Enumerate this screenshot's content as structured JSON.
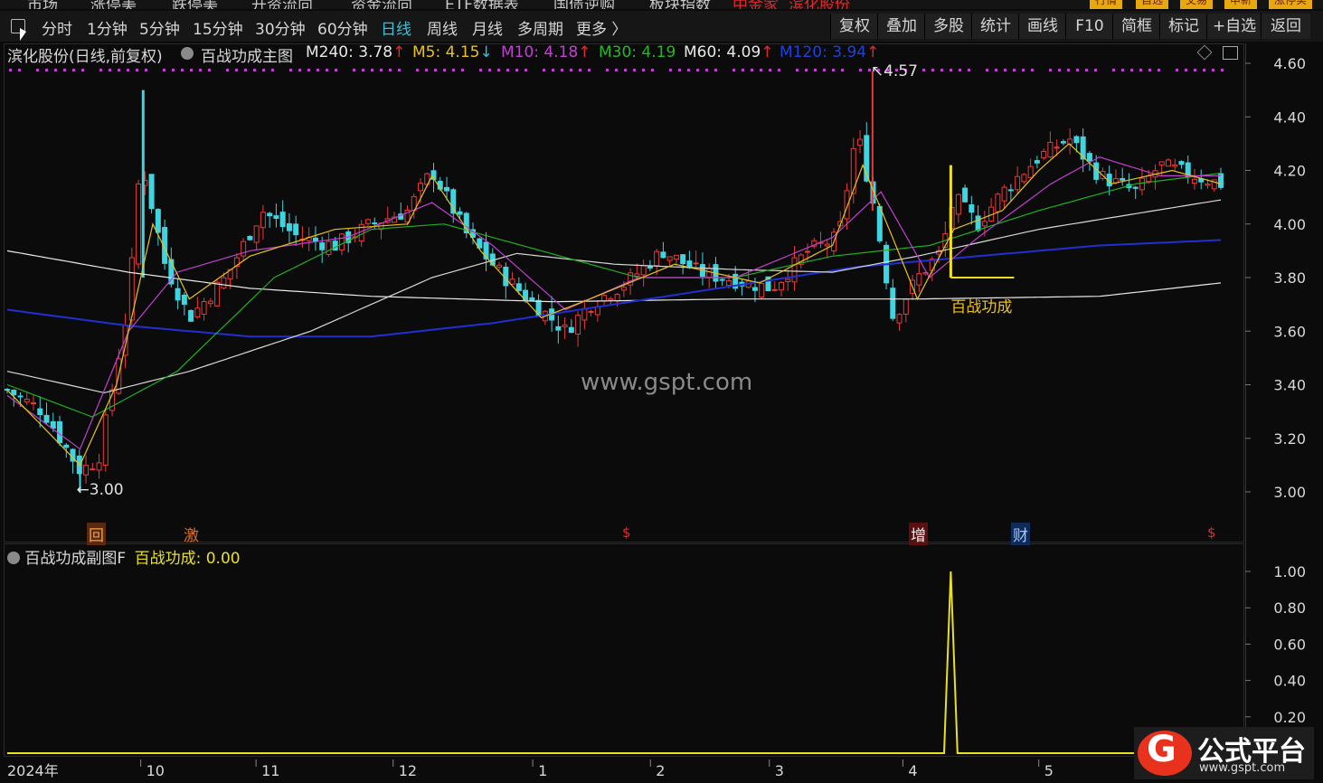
{
  "topnav": {
    "items": [
      "市场",
      "涨停美",
      "跌停美",
      "开资流向",
      "资金流向",
      "ETF数据表",
      "国债逆购",
      "板块指数",
      "中金家",
      "滨化股份"
    ],
    "right_tabs": [
      "行情",
      "自选",
      "交易",
      "申新",
      "涨停实"
    ]
  },
  "toolbar": {
    "periods": [
      "分时",
      "1分钟",
      "5分钟",
      "15分钟",
      "30分钟",
      "60分钟",
      "日线",
      "周线",
      "月线",
      "多周期",
      "更多 〉"
    ],
    "active_period": "日线",
    "buttons": [
      "复权",
      "叠加",
      "多股",
      "统计",
      "画线",
      "F10",
      "简框",
      "标记",
      "+自选",
      "返回"
    ]
  },
  "main_chart": {
    "stock_title": "滨化股份(日线,前复权)",
    "indicator_name": "百战功成主图",
    "ma_labels": [
      {
        "text": "M240: 3.78",
        "arrow": "↑",
        "color": "#e8e8e8"
      },
      {
        "text": "M5: 4.15",
        "arrow": "↓",
        "color": "#e8c21a"
      },
      {
        "text": "M10: 4.18",
        "arrow": "↑",
        "color": "#c040d0"
      },
      {
        "text": "M30: 4.19",
        "arrow": "",
        "color": "#25b825"
      },
      {
        "text": "M60: 4.09",
        "arrow": "↑",
        "color": "#e8e8e8"
      },
      {
        "text": "M120: 3.94",
        "arrow": "↑",
        "color": "#2040e0"
      }
    ],
    "high_label": "4.57",
    "low_label": "3.00",
    "annotation": "百战功成",
    "event_markers": [
      {
        "label": "回",
        "color": "#e07020"
      },
      {
        "label": "激",
        "color": "#e07020"
      },
      {
        "label": "$",
        "color": "#e02a2a"
      },
      {
        "label": "增",
        "color": "#c01818"
      },
      {
        "label": "财",
        "color": "#2a6ae0"
      },
      {
        "label": "$",
        "color": "#e02a2a"
      }
    ]
  },
  "sub_chart": {
    "indicator_name": "百战功成副图F",
    "value_label": "百战功成: 0.00"
  },
  "watermark": "www.gspt.com",
  "logo": {
    "title": "公式平台",
    "url": "www.gspt.com",
    "glyph": "G"
  },
  "chart_data": [
    {
      "type": "candlestick",
      "title": "滨化股份(日线,前复权)",
      "ylim": [
        2.92,
        4.65
      ],
      "y_ticks": [
        3.0,
        3.2,
        3.4,
        3.6,
        3.8,
        4.0,
        4.2,
        4.4,
        4.6
      ],
      "x_tick_labels": [
        "2024年",
        "10",
        "11",
        "12",
        "1",
        "2",
        "3",
        "4",
        "5"
      ],
      "high_marker": 4.57,
      "low_marker": 3.0,
      "close_path": [
        {
          "t": 0.0,
          "v": 3.38
        },
        {
          "t": 0.03,
          "v": 3.3
        },
        {
          "t": 0.06,
          "v": 3.08
        },
        {
          "t": 0.075,
          "v": 3.12
        },
        {
          "t": 0.085,
          "v": 3.35
        },
        {
          "t": 0.1,
          "v": 3.7
        },
        {
          "t": 0.11,
          "v": 4.25
        },
        {
          "t": 0.13,
          "v": 3.85
        },
        {
          "t": 0.15,
          "v": 3.65
        },
        {
          "t": 0.18,
          "v": 3.8
        },
        {
          "t": 0.21,
          "v": 4.05
        },
        {
          "t": 0.24,
          "v": 3.95
        },
        {
          "t": 0.27,
          "v": 3.92
        },
        {
          "t": 0.3,
          "v": 4.0
        },
        {
          "t": 0.33,
          "v": 4.05
        },
        {
          "t": 0.35,
          "v": 4.2
        },
        {
          "t": 0.38,
          "v": 3.95
        },
        {
          "t": 0.41,
          "v": 3.8
        },
        {
          "t": 0.44,
          "v": 3.68
        },
        {
          "t": 0.46,
          "v": 3.6
        },
        {
          "t": 0.48,
          "v": 3.7
        },
        {
          "t": 0.51,
          "v": 3.78
        },
        {
          "t": 0.54,
          "v": 3.9
        },
        {
          "t": 0.57,
          "v": 3.82
        },
        {
          "t": 0.6,
          "v": 3.79
        },
        {
          "t": 0.63,
          "v": 3.76
        },
        {
          "t": 0.66,
          "v": 3.9
        },
        {
          "t": 0.685,
          "v": 3.95
        },
        {
          "t": 0.7,
          "v": 4.35
        },
        {
          "t": 0.715,
          "v": 4.05
        },
        {
          "t": 0.73,
          "v": 3.65
        },
        {
          "t": 0.75,
          "v": 3.8
        },
        {
          "t": 0.77,
          "v": 3.9
        },
        {
          "t": 0.78,
          "v": 4.1
        },
        {
          "t": 0.8,
          "v": 4.0
        },
        {
          "t": 0.82,
          "v": 4.12
        },
        {
          "t": 0.85,
          "v": 4.25
        },
        {
          "t": 0.875,
          "v": 4.32
        },
        {
          "t": 0.9,
          "v": 4.18
        },
        {
          "t": 0.93,
          "v": 4.12
        },
        {
          "t": 0.95,
          "v": 4.22
        },
        {
          "t": 1.0,
          "v": 4.15
        }
      ],
      "series": [
        {
          "name": "M240",
          "last": 3.78,
          "color": "#e8e8e8",
          "points": [
            {
              "t": 0.0,
              "v": 3.9
            },
            {
              "t": 0.1,
              "v": 3.82
            },
            {
              "t": 0.2,
              "v": 3.76
            },
            {
              "t": 0.3,
              "v": 3.73
            },
            {
              "t": 0.45,
              "v": 3.71
            },
            {
              "t": 0.6,
              "v": 3.72
            },
            {
              "t": 0.75,
              "v": 3.72
            },
            {
              "t": 0.9,
              "v": 3.73
            },
            {
              "t": 1.0,
              "v": 3.78
            }
          ]
        },
        {
          "name": "M120",
          "last": 3.94,
          "color": "#2030d0",
          "points": [
            {
              "t": 0.0,
              "v": 3.68
            },
            {
              "t": 0.1,
              "v": 3.62
            },
            {
              "t": 0.2,
              "v": 3.58
            },
            {
              "t": 0.3,
              "v": 3.58
            },
            {
              "t": 0.4,
              "v": 3.63
            },
            {
              "t": 0.5,
              "v": 3.7
            },
            {
              "t": 0.6,
              "v": 3.77
            },
            {
              "t": 0.7,
              "v": 3.84
            },
            {
              "t": 0.8,
              "v": 3.88
            },
            {
              "t": 0.9,
              "v": 3.92
            },
            {
              "t": 1.0,
              "v": 3.94
            }
          ]
        },
        {
          "name": "M60",
          "last": 4.09,
          "color": "#d8d8d8",
          "points": [
            {
              "t": 0.0,
              "v": 3.45
            },
            {
              "t": 0.08,
              "v": 3.37
            },
            {
              "t": 0.15,
              "v": 3.45
            },
            {
              "t": 0.25,
              "v": 3.6
            },
            {
              "t": 0.35,
              "v": 3.8
            },
            {
              "t": 0.42,
              "v": 3.89
            },
            {
              "t": 0.5,
              "v": 3.85
            },
            {
              "t": 0.6,
              "v": 3.83
            },
            {
              "t": 0.68,
              "v": 3.82
            },
            {
              "t": 0.75,
              "v": 3.88
            },
            {
              "t": 0.85,
              "v": 3.98
            },
            {
              "t": 1.0,
              "v": 4.09
            }
          ]
        },
        {
          "name": "M30",
          "last": 4.19,
          "color": "#20b020",
          "points": [
            {
              "t": 0.0,
              "v": 3.4
            },
            {
              "t": 0.07,
              "v": 3.28
            },
            {
              "t": 0.14,
              "v": 3.45
            },
            {
              "t": 0.22,
              "v": 3.8
            },
            {
              "t": 0.3,
              "v": 3.98
            },
            {
              "t": 0.36,
              "v": 4.0
            },
            {
              "t": 0.44,
              "v": 3.9
            },
            {
              "t": 0.52,
              "v": 3.8
            },
            {
              "t": 0.6,
              "v": 3.8
            },
            {
              "t": 0.68,
              "v": 3.88
            },
            {
              "t": 0.76,
              "v": 3.92
            },
            {
              "t": 0.85,
              "v": 4.05
            },
            {
              "t": 0.93,
              "v": 4.15
            },
            {
              "t": 1.0,
              "v": 4.19
            }
          ]
        },
        {
          "name": "M10",
          "last": 4.18,
          "color": "#c040d0",
          "points": [
            {
              "t": 0.0,
              "v": 3.36
            },
            {
              "t": 0.06,
              "v": 3.16
            },
            {
              "t": 0.1,
              "v": 3.6
            },
            {
              "t": 0.14,
              "v": 3.82
            },
            {
              "t": 0.2,
              "v": 3.9
            },
            {
              "t": 0.28,
              "v": 3.95
            },
            {
              "t": 0.35,
              "v": 4.08
            },
            {
              "t": 0.4,
              "v": 3.92
            },
            {
              "t": 0.46,
              "v": 3.68
            },
            {
              "t": 0.52,
              "v": 3.8
            },
            {
              "t": 0.6,
              "v": 3.8
            },
            {
              "t": 0.68,
              "v": 3.95
            },
            {
              "t": 0.72,
              "v": 4.12
            },
            {
              "t": 0.76,
              "v": 3.8
            },
            {
              "t": 0.8,
              "v": 3.95
            },
            {
              "t": 0.86,
              "v": 4.15
            },
            {
              "t": 0.9,
              "v": 4.25
            },
            {
              "t": 0.95,
              "v": 4.18
            },
            {
              "t": 1.0,
              "v": 4.18
            }
          ]
        },
        {
          "name": "M5",
          "last": 4.15,
          "color": "#e8c21a",
          "points": [
            {
              "t": 0.0,
              "v": 3.38
            },
            {
              "t": 0.06,
              "v": 3.1
            },
            {
              "t": 0.09,
              "v": 3.4
            },
            {
              "t": 0.12,
              "v": 4.0
            },
            {
              "t": 0.15,
              "v": 3.72
            },
            {
              "t": 0.2,
              "v": 3.88
            },
            {
              "t": 0.27,
              "v": 3.98
            },
            {
              "t": 0.33,
              "v": 4.0
            },
            {
              "t": 0.35,
              "v": 4.18
            },
            {
              "t": 0.39,
              "v": 3.9
            },
            {
              "t": 0.44,
              "v": 3.65
            },
            {
              "t": 0.48,
              "v": 3.72
            },
            {
              "t": 0.55,
              "v": 3.85
            },
            {
              "t": 0.62,
              "v": 3.78
            },
            {
              "t": 0.68,
              "v": 3.92
            },
            {
              "t": 0.705,
              "v": 4.22
            },
            {
              "t": 0.725,
              "v": 4.0
            },
            {
              "t": 0.75,
              "v": 3.72
            },
            {
              "t": 0.78,
              "v": 3.98
            },
            {
              "t": 0.82,
              "v": 4.05
            },
            {
              "t": 0.85,
              "v": 4.2
            },
            {
              "t": 0.875,
              "v": 4.3
            },
            {
              "t": 0.91,
              "v": 4.15
            },
            {
              "t": 0.96,
              "v": 4.2
            },
            {
              "t": 1.0,
              "v": 4.15
            }
          ]
        }
      ]
    },
    {
      "type": "line",
      "title": "百战功成副图F",
      "ylim": [
        0.0,
        1.1
      ],
      "y_ticks": [
        0.2,
        0.4,
        0.6,
        0.8,
        1.0
      ],
      "series": [
        {
          "name": "百战功成",
          "color": "#e8e020",
          "points": [
            {
              "t": 0.0,
              "v": 0
            },
            {
              "t": 0.772,
              "v": 0
            },
            {
              "t": 0.7775,
              "v": 1.0
            },
            {
              "t": 0.783,
              "v": 0
            },
            {
              "t": 1.0,
              "v": 0
            }
          ]
        }
      ]
    }
  ]
}
